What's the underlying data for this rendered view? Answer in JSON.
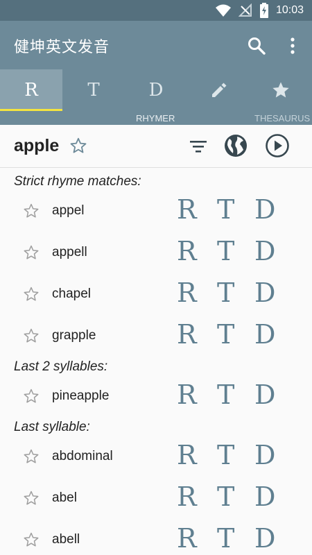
{
  "status": {
    "time": "10:03",
    "wifi_icon": "wifi-icon",
    "signal_icon": "no-signal-icon",
    "battery_icon": "battery-charging-icon"
  },
  "app_bar": {
    "title": "健坤英文发音",
    "search_icon": "search-icon",
    "menu_icon": "overflow-menu-icon"
  },
  "tabs": [
    {
      "label": "R",
      "active": true
    },
    {
      "label": "T",
      "active": false
    },
    {
      "label": "D",
      "active": false
    },
    {
      "label": "pencil-icon",
      "active": false
    },
    {
      "label": "star-icon",
      "active": false
    }
  ],
  "subtabs": {
    "rhymer": "RHYMER",
    "thesaurus": "THESAURUS"
  },
  "colors": {
    "status_bar": "#55707e",
    "app_bar": "#6d8a99",
    "active_tab": "#8aa2ae",
    "indicator": "#f4e43f",
    "letter": "#5f7f90"
  },
  "header": {
    "word": "apple",
    "star_icon": "star-outline-icon",
    "filter_icon": "filter-icon",
    "globe_icon": "globe-icon",
    "play_icon": "play-circle-icon"
  },
  "results": {
    "sections": [
      {
        "label": "Strict rhyme matches:",
        "words": [
          "appel",
          "appell",
          "chapel",
          "grapple"
        ]
      },
      {
        "label": "Last 2 syllables:",
        "words": [
          "pineapple"
        ]
      },
      {
        "label": "Last syllable:",
        "words": [
          "abdominal",
          "abel",
          "abell"
        ]
      }
    ],
    "row_letters": {
      "r": "R",
      "t": "T",
      "d": "D"
    }
  }
}
